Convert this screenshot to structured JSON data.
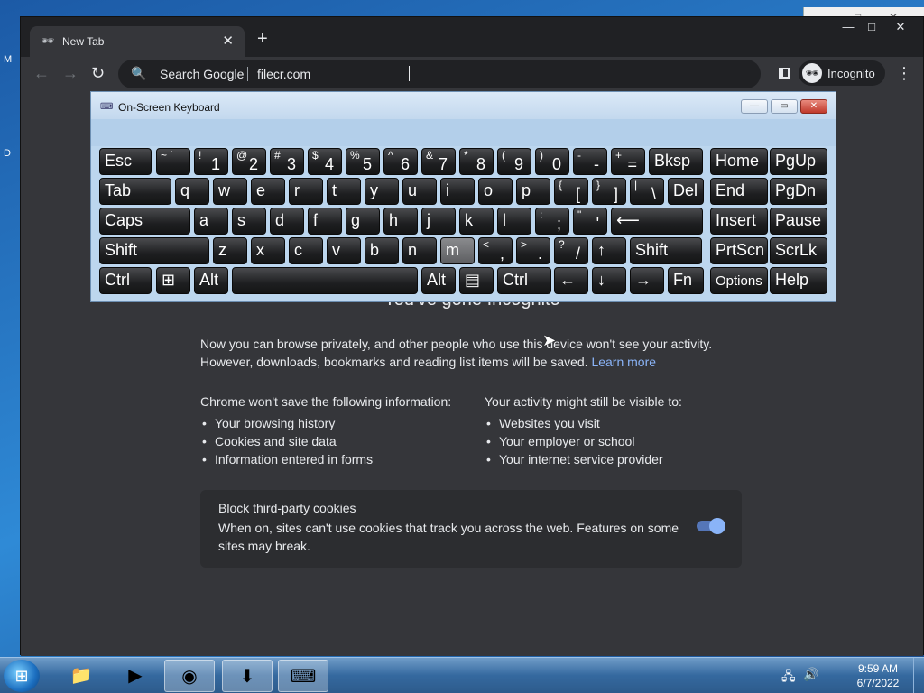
{
  "desktop": {
    "labels": [
      "M",
      "D"
    ]
  },
  "bg_window": {
    "minimize": "—",
    "maximize": "□",
    "close": "✕"
  },
  "browser": {
    "tab": {
      "title": "New Tab",
      "close": "✕",
      "icon": "incognito-icon"
    },
    "new_tab": "+",
    "window_controls": {
      "minimize": "—",
      "maximize": "□",
      "close": "✕"
    },
    "toolbar": {
      "back": "←",
      "forward": "→",
      "reload": "↻",
      "search_hint": "Search Google",
      "address_value": "filecr.com",
      "profile_label": "Incognito"
    },
    "content": {
      "heading": "You've gone Incognito",
      "para": "Now you can browse privately, and other people who use this device won't see your activity. However, downloads, bookmarks and reading list items will be saved.",
      "learn_more": "Learn more",
      "left_heading": "Chrome won't save the following information:",
      "left_items": [
        "Your browsing history",
        "Cookies and site data",
        "Information entered in forms"
      ],
      "right_heading": "Your activity might still be visible to:",
      "right_items": [
        "Websites you visit",
        "Your employer or school",
        "Your internet service provider"
      ],
      "cookie_title": "Block third-party cookies",
      "cookie_desc": "When on, sites can't use cookies that track you across the web. Features on some sites may break.",
      "cookie_toggle_on": true
    }
  },
  "osk": {
    "title": "On-Screen Keyboard",
    "controls": {
      "minimize": "—",
      "restore": "▭",
      "close": "✕"
    },
    "keys": {
      "esc": "Esc",
      "k_tilde": {
        "top": "~ `",
        "bottom": ""
      },
      "k1": {
        "top": "!",
        "bottom": "1"
      },
      "k2": {
        "top": "@",
        "bottom": "2"
      },
      "k3": {
        "top": "#",
        "bottom": "3"
      },
      "k4": {
        "top": "$",
        "bottom": "4"
      },
      "k5": {
        "top": "%",
        "bottom": "5"
      },
      "k6": {
        "top": "^",
        "bottom": "6"
      },
      "k7": {
        "top": "&",
        "bottom": "7"
      },
      "k8": {
        "top": "*",
        "bottom": "8"
      },
      "k9": {
        "top": "(",
        "bottom": "9"
      },
      "k0": {
        "top": ")",
        "bottom": "0"
      },
      "k_minus": {
        "top": "-",
        "bottom": "-"
      },
      "k_plus": {
        "top": "+",
        "bottom": "="
      },
      "bksp": "Bksp",
      "home": "Home",
      "pgup": "PgUp",
      "tab": "Tab",
      "q": "q",
      "w": "w",
      "e": "e",
      "r": "r",
      "t": "t",
      "y": "y",
      "u": "u",
      "i": "i",
      "o": "o",
      "p": "p",
      "k_lbrack": {
        "top": "{",
        "bottom": "["
      },
      "k_rbrack": {
        "top": "}",
        "bottom": "]"
      },
      "k_bslash": {
        "top": "|",
        "bottom": "\\"
      },
      "del": "Del",
      "end": "End",
      "pgdn": "PgDn",
      "caps": "Caps",
      "a": "a",
      "s": "s",
      "d": "d",
      "f": "f",
      "g": "g",
      "h": "h",
      "j": "j",
      "k": "k",
      "l": "l",
      "k_semi": {
        "top": ":",
        "bottom": ";"
      },
      "k_quote": {
        "top": "\"",
        "bottom": "'"
      },
      "enter": "⟵",
      "insert": "Insert",
      "pause": "Pause",
      "lshift": "Shift",
      "z": "z",
      "x": "x",
      "c": "c",
      "v": "v",
      "b": "b",
      "n": "n",
      "m": "m",
      "k_comma": {
        "top": "<",
        "bottom": ","
      },
      "k_period": {
        "top": ">",
        "bottom": "."
      },
      "k_slash": {
        "top": "?",
        "bottom": "/"
      },
      "up": "↑",
      "rshift": "Shift",
      "prtscn": "PrtScn",
      "scrlk": "ScrLk",
      "lctrl": "Ctrl",
      "win": "⊞",
      "lalt": "Alt",
      "space": "",
      "ralt": "Alt",
      "menu": "▤",
      "rctrl": "Ctrl",
      "left": "←",
      "down": "↓",
      "right": "→",
      "fn": "Fn",
      "options": "Options",
      "help": "Help"
    }
  },
  "taskbar": {
    "start_icon": "windows-start-icon",
    "apps": [
      "file-explorer-icon",
      "media-player-icon",
      "chrome-icon",
      "download-manager-icon",
      "on-screen-keyboard-icon"
    ],
    "tray": [
      "network-icon",
      "volume-icon"
    ],
    "time": "9:59 AM",
    "date": "6/7/2022"
  }
}
